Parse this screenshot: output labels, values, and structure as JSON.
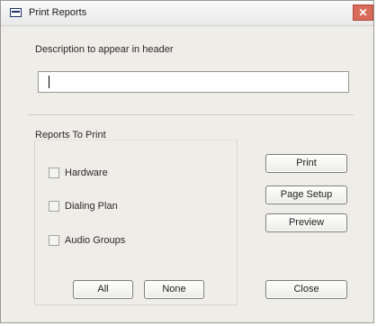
{
  "window": {
    "title": "Print Reports",
    "close_glyph": "✕"
  },
  "description": {
    "label": "Description to appear in header",
    "value": ""
  },
  "reports": {
    "label": "Reports To Print",
    "items": [
      {
        "label": "Hardware",
        "checked": false
      },
      {
        "label": "Dialing Plan",
        "checked": false
      },
      {
        "label": "Audio Groups",
        "checked": false
      }
    ],
    "all_label": "All",
    "none_label": "None"
  },
  "actions": {
    "print_label": "Print",
    "page_setup_label": "Page Setup",
    "preview_label": "Preview",
    "close_label": "Close"
  }
}
